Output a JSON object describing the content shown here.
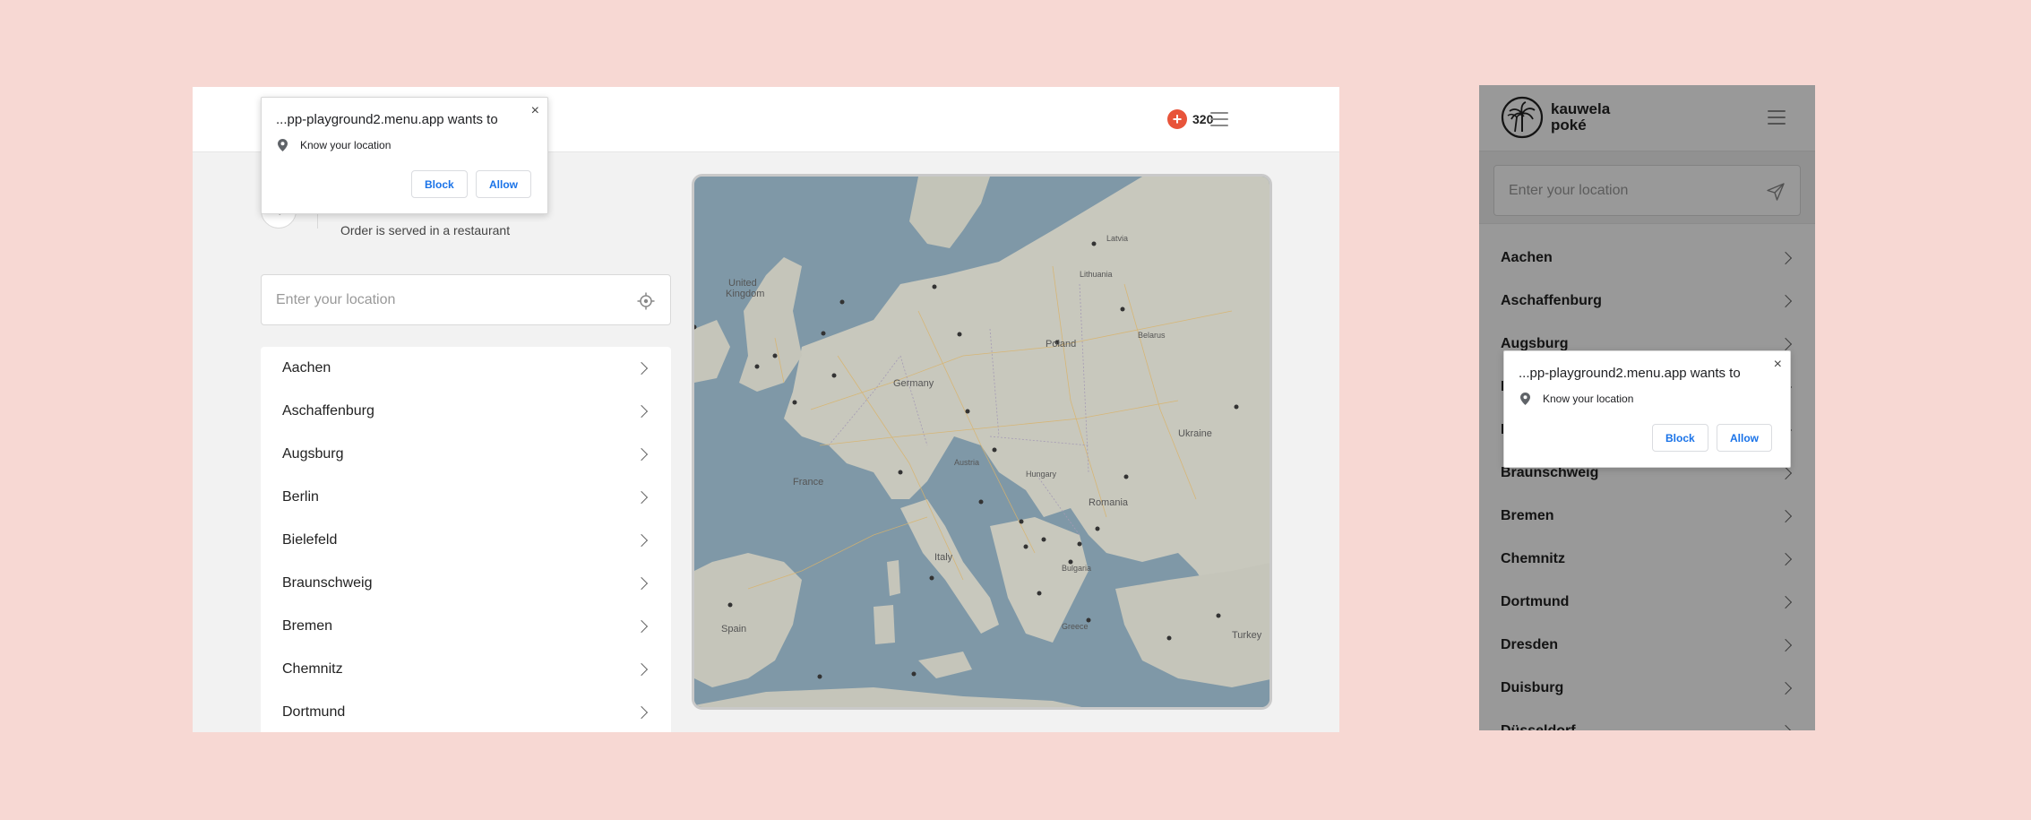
{
  "permission_prompt": {
    "title": "...pp-playground2.menu.app wants to",
    "close": "×",
    "permission": "Know your location",
    "block_label": "Block",
    "allow_label": "Allow"
  },
  "desktop": {
    "points": "320",
    "back": "‹",
    "order_note": "Order is served in a restaurant",
    "location_placeholder": "Enter your location",
    "cities": [
      "Aachen",
      "Aschaffenburg",
      "Augsburg",
      "Berlin",
      "Bielefeld",
      "Braunschweig",
      "Bremen",
      "Chemnitz",
      "Dortmund"
    ]
  },
  "map": {
    "labels": [
      {
        "text": "United\nKingdom"
      },
      {
        "text": "France"
      },
      {
        "text": "Germany"
      },
      {
        "text": "Poland"
      },
      {
        "text": "Ukraine"
      },
      {
        "text": "Romania"
      },
      {
        "text": "Italy"
      },
      {
        "text": "Spain"
      },
      {
        "text": "Turkey"
      },
      {
        "text": "Bulgaria"
      },
      {
        "text": "Greece"
      },
      {
        "text": "Hungary"
      },
      {
        "text": "Belarus"
      },
      {
        "text": "Lithuania"
      },
      {
        "text": "Latvia"
      },
      {
        "text": "Austria"
      }
    ]
  },
  "mobile": {
    "brand_line1": "kauwela",
    "brand_line2": "poké",
    "location_placeholder": "Enter your location",
    "cities": [
      "Aachen",
      "Aschaffenburg",
      "Augsburg",
      "Berlin",
      "Bielefeld",
      "Braunschweig",
      "Bremen",
      "Chemnitz",
      "Dortmund",
      "Dresden",
      "Duisburg",
      "Düsseldorf"
    ]
  }
}
